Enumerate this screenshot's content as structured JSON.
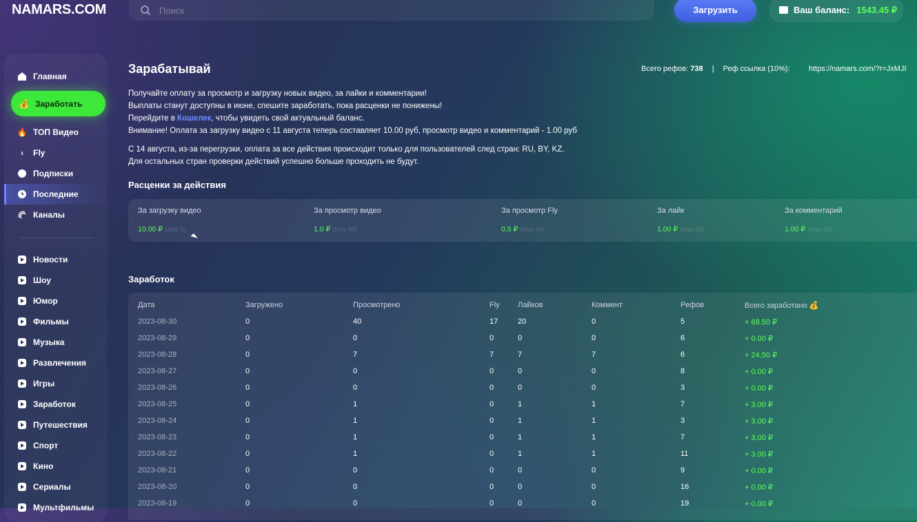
{
  "header": {
    "logo": "NAMARS.COM",
    "search_placeholder": "Поиск",
    "upload_label": "Загрузить",
    "balance_label": "Ваш баланс:",
    "balance_amount": "1543.45 ₽"
  },
  "sidebar": {
    "main_items": [
      {
        "label": "Главная",
        "icon": "home-icon"
      },
      {
        "label": "Заработать",
        "icon": "money-bag-icon"
      },
      {
        "label": "ТОП Видео",
        "icon": "fire-icon"
      },
      {
        "label": "Fly",
        "icon": "chevron-right-icon"
      },
      {
        "label": "Подписки",
        "icon": "star-icon"
      },
      {
        "label": "Последние",
        "icon": "clock-icon"
      },
      {
        "label": "Каналы",
        "icon": "broadcast-icon"
      }
    ],
    "categories": [
      "Новости",
      "Шоу",
      "Юмор",
      "Фильмы",
      "Музыка",
      "Развлечения",
      "Игры",
      "Заработок",
      "Путешествия",
      "Спорт",
      "Кино",
      "Сериалы",
      "Мультфильмы"
    ]
  },
  "main": {
    "title": "Зарабатывай",
    "refs_label": "Всего рефов:",
    "refs_count": "738",
    "refs_separator": "|",
    "ref_link_label": "Реф ссылка (10%):",
    "ref_link": "https://namars.com/?r=JxMJI",
    "info": {
      "line1": "Получайте оплату за просмотр и загрузку новых видео, за лайки и комментарии!",
      "line2": "Выплаты станут доступны в июне, спешите заработать, пока расценки не понижены!",
      "line3_before": "Перейдите в ",
      "line3_link": "Кошелек",
      "line3_after": ", чтобы увидеть свой актуальный баланс.",
      "line4": "Внимание! Оплата за загрузку видео с 11 августа теперь составляет 10.00 руб, просмотр видео и комментарий - 1.00 руб",
      "line5": "С 14 августа, из-за перегрузки, оплата за все действия происходит только для пользователей след стран: RU, BY, KZ.",
      "line6": "Для остальных стран проверки действий успешно больше проходить не будут."
    },
    "prices_title": "Расценки за действия",
    "prices": [
      {
        "label": "За загрузку видео",
        "value": "10.00 ₽",
        "sub": "(max 5)"
      },
      {
        "label": "За просмотр видео",
        "value": "1.0 ₽",
        "sub": "(max 40)"
      },
      {
        "label": "За просмотр Fly",
        "value": "0.5 ₽",
        "sub": "(max 40)"
      },
      {
        "label": "За лайк",
        "value": "1.00 ₽",
        "sub": "(max 30)"
      },
      {
        "label": "За комментарий",
        "value": "1.00 ₽",
        "sub": "(max 30)"
      }
    ],
    "earnings_title": "Заработок",
    "earnings_headers": [
      "Дата",
      "Загружено",
      "Просмотрено",
      "Fly",
      "Лайков",
      "Коммент",
      "Рефов",
      "Всего заработано 💰"
    ],
    "earnings_rows": [
      [
        "2023-08-30",
        "0",
        "40",
        "17",
        "20",
        "0",
        "5",
        "+ 68.50 ₽"
      ],
      [
        "2023-08-29",
        "0",
        "0",
        "0",
        "0",
        "0",
        "6",
        "+ 0.00 ₽"
      ],
      [
        "2023-08-28",
        "0",
        "7",
        "7",
        "7",
        "7",
        "6",
        "+ 24.50 ₽"
      ],
      [
        "2023-08-27",
        "0",
        "0",
        "0",
        "0",
        "0",
        "8",
        "+ 0.00 ₽"
      ],
      [
        "2023-08-26",
        "0",
        "0",
        "0",
        "0",
        "0",
        "3",
        "+ 0.00 ₽"
      ],
      [
        "2023-08-25",
        "0",
        "1",
        "0",
        "1",
        "1",
        "7",
        "+ 3.00 ₽"
      ],
      [
        "2023-08-24",
        "0",
        "1",
        "0",
        "1",
        "1",
        "3",
        "+ 3.00 ₽"
      ],
      [
        "2023-08-23",
        "0",
        "1",
        "0",
        "1",
        "1",
        "7",
        "+ 3.00 ₽"
      ],
      [
        "2023-08-22",
        "0",
        "1",
        "0",
        "1",
        "1",
        "11",
        "+ 3.00 ₽"
      ],
      [
        "2023-08-21",
        "0",
        "0",
        "0",
        "0",
        "0",
        "9",
        "+ 0.00 ₽"
      ],
      [
        "2023-08-20",
        "0",
        "0",
        "0",
        "0",
        "0",
        "16",
        "+ 0.00 ₽"
      ],
      [
        "2023-08-19",
        "0",
        "0",
        "0",
        "0",
        "0",
        "19",
        "+ 0.00 ₽"
      ]
    ]
  },
  "colors": {
    "accent_green": "#3ee83b",
    "accent_blue": "#4f6ff0",
    "value_green": "#5dff5a"
  }
}
